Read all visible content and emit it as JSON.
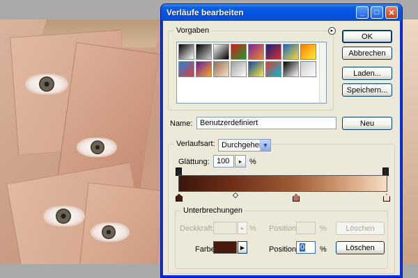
{
  "dialog": {
    "title": "Verläufe bearbeiten",
    "title_buttons": [
      "_",
      "□",
      "✕"
    ]
  },
  "presets": {
    "label": "Vorgaben",
    "swatches": [
      [
        "#000000",
        "#ffffff"
      ],
      [
        "#000000",
        "#cccccc"
      ],
      [
        "#ffffff",
        "#000000"
      ],
      [
        "#d21e1e",
        "#1e9a2e"
      ],
      [
        "#7b1fa2",
        "#f08a24"
      ],
      [
        "#1a237e",
        "#d32f2f"
      ],
      [
        "#1565c0",
        "#fdd835"
      ],
      [
        "#f57c00",
        "#ffeb3b"
      ],
      [
        "#1e88e5",
        "#e53935"
      ],
      [
        "#6a1b9a",
        "#f9a825"
      ],
      [
        "#8d6e63",
        "#ffe0b2"
      ],
      [
        "#9e9e9e",
        "#ffffff"
      ],
      [
        "#0d47a1",
        "#ffeb3b"
      ],
      [
        "#e53935",
        "#00bcd4"
      ],
      [
        "#000000",
        "#ffffff"
      ],
      [
        "#cccccc",
        "#ffffff"
      ]
    ]
  },
  "buttons": {
    "ok": "OK",
    "cancel": "Abbrechen",
    "load": "Laden...",
    "save": "Speichern...",
    "new": "Neu",
    "delete_opacity": "Löschen",
    "delete_color": "Löschen"
  },
  "name_field": {
    "label": "Name:",
    "value": "Benutzerdefiniert"
  },
  "gradient_type": {
    "label": "Verlaufsart:",
    "value": "Durchgehend"
  },
  "smoothness": {
    "label": "Glättung:",
    "value": "100",
    "unit": "%"
  },
  "gradient_colors": {
    "start": "#3b160b",
    "end": "#f6dec4",
    "selected_stop_color": "#4a1a0c",
    "mid_stop_color": "#b8735a"
  },
  "stops": {
    "label": "Unterbrechungen",
    "opacity_label": "Deckkraft:",
    "opacity_unit": "%",
    "opacity_position_label": "Position:",
    "opacity_position_unit": "%",
    "color_label": "Farbe:",
    "color_position_label": "Position:",
    "color_position_value": "0",
    "color_position_unit": "%"
  }
}
